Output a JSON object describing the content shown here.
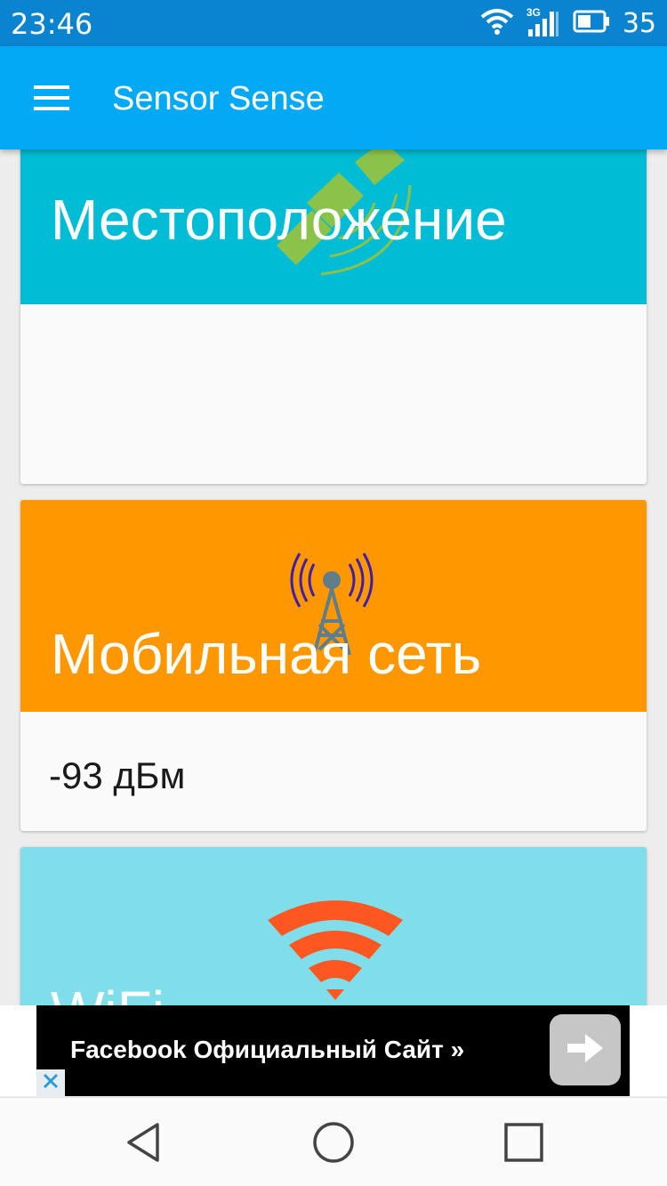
{
  "status_bar": {
    "time": "23:46",
    "network_label": "3G",
    "battery": "35",
    "icons": [
      "wifi-icon",
      "cell-signal-icon",
      "battery-icon"
    ]
  },
  "app_bar": {
    "title": "Sensor Sense",
    "menu_icon": "hamburger-menu-icon"
  },
  "cards": {
    "location": {
      "title": "Местоположение",
      "value": "",
      "color": "#00bcd4",
      "icon": "satellite-icon"
    },
    "mobile": {
      "title": "Мобильная сеть",
      "value": "-93 дБм",
      "color": "#ff9800",
      "icon": "cell-tower-icon"
    },
    "wifi": {
      "title": "WiFi",
      "value": "",
      "color": "#80deea",
      "icon": "wifi-signal-icon"
    }
  },
  "ad": {
    "text": "Facebook Официальный Сайт »",
    "arrow_icon": "arrow-right-icon",
    "close_icon": "close-icon"
  },
  "nav_bar": {
    "icons": [
      "back-icon",
      "home-icon",
      "recents-icon"
    ]
  }
}
